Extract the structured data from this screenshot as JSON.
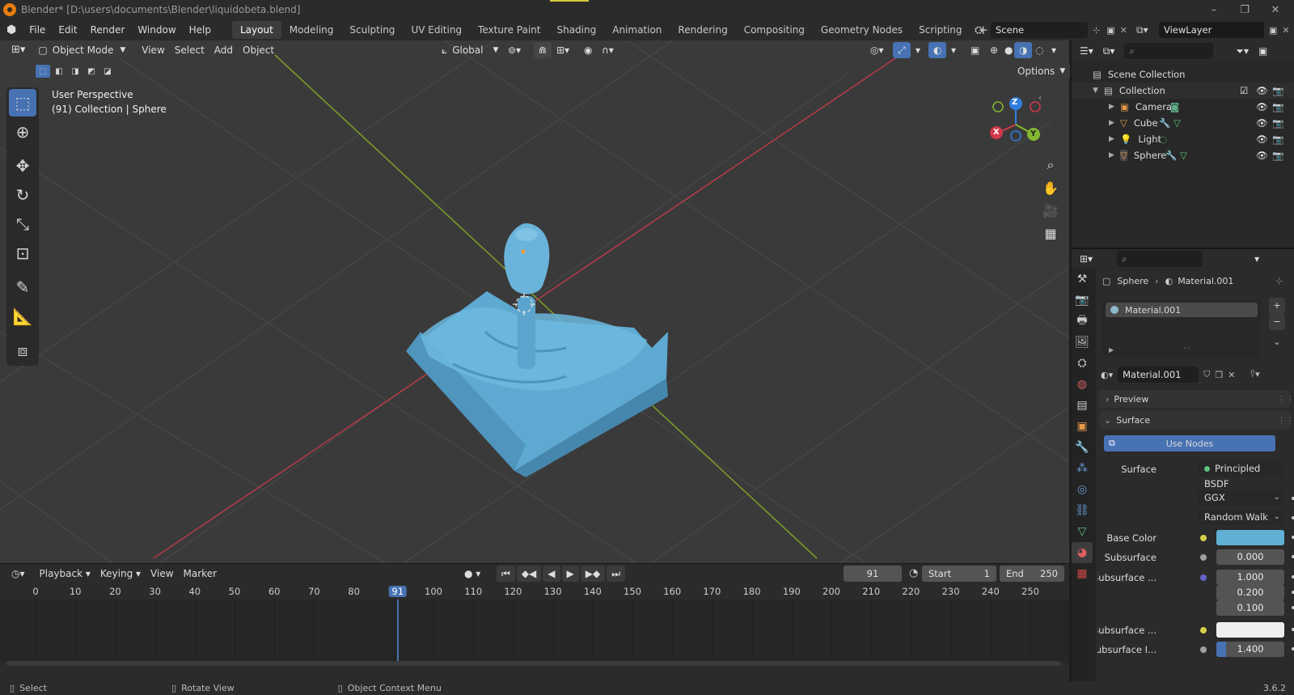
{
  "window": {
    "title": "Blender* [D:\\users\\documents\\Blender\\liquidobeta.blend]",
    "controls": [
      "–",
      "❐",
      "✕"
    ]
  },
  "menus": [
    "File",
    "Edit",
    "Render",
    "Window",
    "Help"
  ],
  "workspaces": [
    "Layout",
    "Modeling",
    "Sculpting",
    "UV Editing",
    "Texture Paint",
    "Shading",
    "Animation",
    "Rendering",
    "Compositing",
    "Geometry Nodes",
    "Scripting"
  ],
  "active_workspace": "Layout",
  "scene": {
    "name": "Scene",
    "view_layer": "ViewLayer"
  },
  "viewport": {
    "mode": "Object Mode",
    "menus": [
      "View",
      "Select",
      "Add",
      "Object"
    ],
    "transform": "Global",
    "options_label": "Options",
    "perspective": "User Perspective",
    "context": "(91) Collection | Sphere",
    "gizmo": {
      "z": "Z",
      "x": "X",
      "y": "Y"
    }
  },
  "outliner": {
    "root": "Scene Collection",
    "collection": "Collection",
    "items": [
      "Camera",
      "Cube",
      "Light",
      "Sphere"
    ]
  },
  "properties": {
    "breadcrumb": {
      "object": "Sphere",
      "material": "Material.001"
    },
    "slot": "Material.001",
    "material_name": "Material.001",
    "panels": {
      "preview": "Preview",
      "surface": "Surface"
    },
    "use_nodes": "Use Nodes",
    "surface_label": "Surface",
    "surface_value": "Principled BSDF",
    "distribution": "GGX",
    "subsurface_method": "Random Walk",
    "rows": [
      {
        "label": "Base Color",
        "value": ""
      },
      {
        "label": "Subsurface",
        "value": "0.000"
      },
      {
        "label": "Subsurface ...",
        "value": "1.000"
      },
      {
        "label": "",
        "value": "0.200"
      },
      {
        "label": "",
        "value": "0.100"
      },
      {
        "label": "Subsurface ...",
        "value": ""
      },
      {
        "label": "Subsurface I...",
        "value": "1.400"
      }
    ],
    "colors": {
      "base_color": "#5fb0d4",
      "subsurface_color": "#f0f0f0",
      "accent": "#4772b3"
    }
  },
  "timeline": {
    "menus": [
      "Playback",
      "Keying",
      "View",
      "Marker"
    ],
    "current_frame": "91",
    "start_label": "Start",
    "start": "1",
    "end_label": "End",
    "end": "250",
    "ruler": [
      "0",
      "10",
      "20",
      "30",
      "40",
      "50",
      "60",
      "70",
      "80",
      "91",
      "100",
      "110",
      "120",
      "130",
      "140",
      "150",
      "160",
      "170",
      "180",
      "190",
      "200",
      "210",
      "220",
      "230",
      "240",
      "250"
    ]
  },
  "status": {
    "select": "Select",
    "rotate": "Rotate View",
    "context_menu": "Object Context Menu",
    "version": "3.6.2"
  }
}
